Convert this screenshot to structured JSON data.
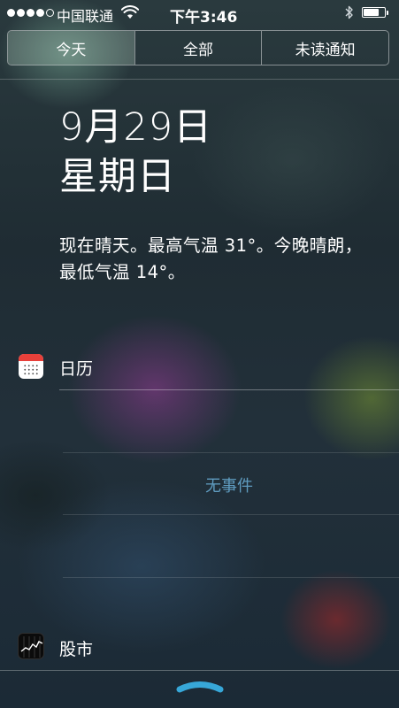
{
  "status_bar": {
    "signal_bars": 4,
    "signal_max": 5,
    "carrier": "中国联通",
    "time": "下午3:46",
    "battery_level": 0.75
  },
  "segments": {
    "items": [
      {
        "label": "今天",
        "selected": true
      },
      {
        "label": "全部",
        "selected": false
      },
      {
        "label": "未读通知",
        "selected": false
      }
    ]
  },
  "today": {
    "date": "9月29日",
    "weekday": "星期日",
    "weather_summary": "现在晴天。最高气温 31°。今晚晴朗，最低气温 14°。"
  },
  "calendar": {
    "title": "日历",
    "empty_text": "无事件",
    "icon": "calendar-icon"
  },
  "stocks": {
    "title": "股市",
    "icon": "stocks-icon"
  },
  "colors": {
    "no_events_text": "#5f9cc0",
    "grabber": "#37a7d8",
    "calendar_header": "#e8403a"
  }
}
